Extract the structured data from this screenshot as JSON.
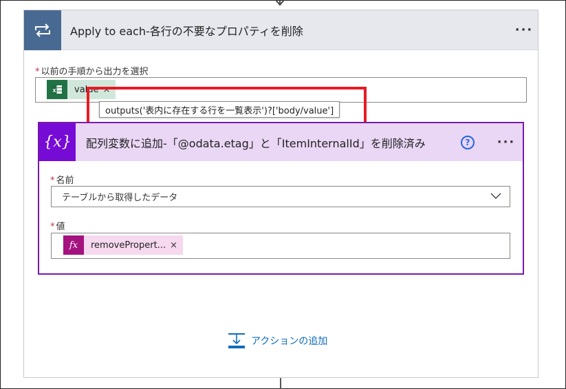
{
  "apply_each": {
    "title": "Apply to each-各行の不要なプロパティを削除",
    "more": "···",
    "field_label": "以前の手順から出力を選択",
    "token_label": "value",
    "token_remove": "×",
    "tooltip": "outputs('表内に存在する行を一覧表示')?['body/value']"
  },
  "append_action": {
    "icon_text": "{x}",
    "title": "配列変数に追加-「@odata.etag」と「ItemInternalId」を削除済み",
    "help": "?",
    "more": "···",
    "name_label": "名前",
    "name_value": "テーブルから取得したデータ",
    "value_label": "値",
    "value_token_icon": "fx",
    "value_token": "removePropert...",
    "value_token_remove": "×"
  },
  "add_action_label": "アクションの追加",
  "required_mark": "*",
  "colors": {
    "loop_header": "#486991",
    "variable_accent": "#770bd6",
    "expression_accent": "#a4127f",
    "excel": "#217346",
    "highlight": "#e61b24",
    "link": "#0f6cbd"
  }
}
